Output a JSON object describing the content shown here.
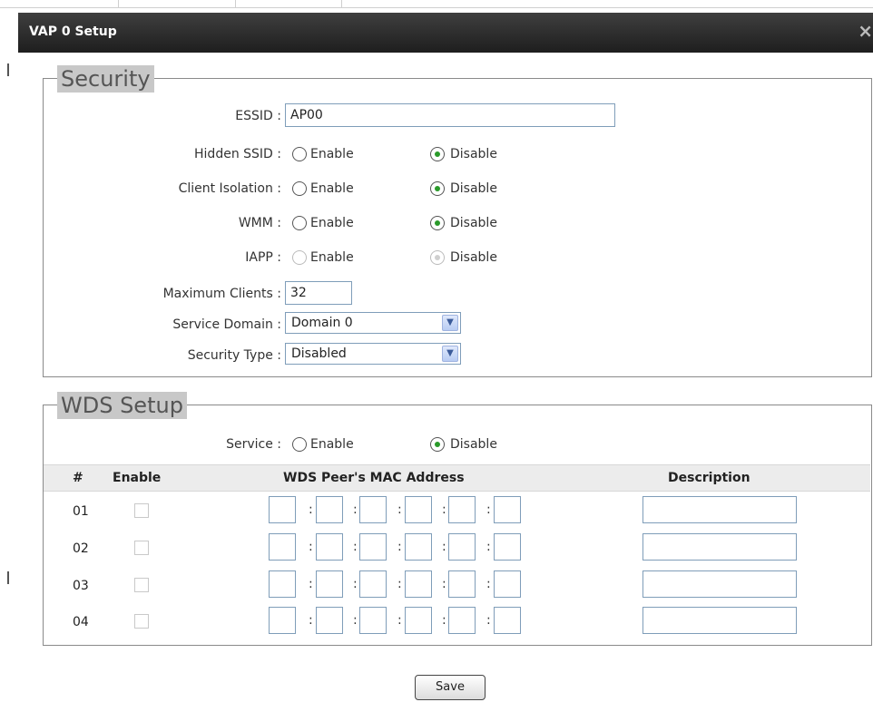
{
  "dialog": {
    "title": "VAP 0 Setup",
    "close_symbol": "×"
  },
  "security": {
    "legend": "Security",
    "essid": {
      "label": "ESSID :",
      "value": "AP00"
    },
    "hidden_ssid": {
      "label": "Hidden SSID :",
      "enable": "Enable",
      "disable": "Disable",
      "selected": "Disable"
    },
    "client_isolation": {
      "label": "Client Isolation :",
      "enable": "Enable",
      "disable": "Disable",
      "selected": "Disable"
    },
    "wmm": {
      "label": "WMM :",
      "enable": "Enable",
      "disable": "Disable",
      "selected": "Disable"
    },
    "iapp": {
      "label": "IAPP :",
      "enable": "Enable",
      "disable": "Disable",
      "selected": "Disable",
      "disabled": true
    },
    "max_clients": {
      "label": "Maximum Clients :",
      "value": "32"
    },
    "service_domain": {
      "label": "Service Domain :",
      "value": "Domain 0"
    },
    "security_type": {
      "label": "Security Type :",
      "value": "Disabled"
    }
  },
  "wds": {
    "legend": "WDS Setup",
    "service": {
      "label": "Service :",
      "enable": "Enable",
      "disable": "Disable",
      "selected": "Disable"
    },
    "columns": [
      "#",
      "Enable",
      "WDS Peer's MAC Address",
      "Description"
    ],
    "rows": [
      {
        "num": "01"
      },
      {
        "num": "02"
      },
      {
        "num": "03"
      },
      {
        "num": "04"
      }
    ],
    "mac_separator": ":"
  },
  "save_label": "Save",
  "colors": {
    "accent_radio": "#2a9a2a",
    "titlebar": "#2a2a2a",
    "legend_bg": "#c8c8c8"
  },
  "icons": {
    "close": "close-icon",
    "dropdown": "chevron-down-icon"
  }
}
